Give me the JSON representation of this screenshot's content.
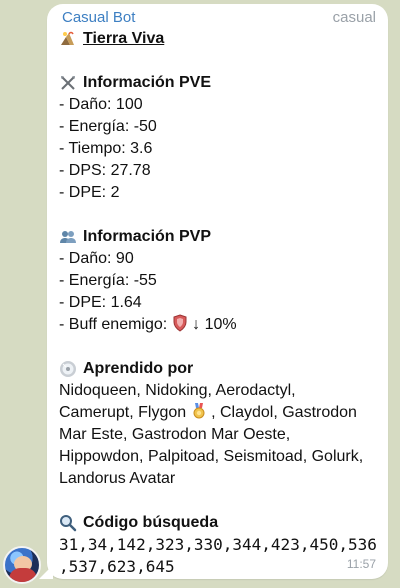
{
  "chat": {
    "sender": "Casual Bot",
    "tag": "casual",
    "time": "11:57"
  },
  "message": {
    "title": "Tierra Viva",
    "pve": {
      "title": "Información PVE",
      "lines": [
        "- Daño: 100",
        "- Energía: -50",
        "- Tiempo: 3.6",
        "- DPS: 27.78",
        "- DPE: 2"
      ]
    },
    "pvp": {
      "title": "Información PVP",
      "lines": [
        "- Daño: 90",
        "- Energía: -55",
        "- DPE: 1.64"
      ],
      "buff_prefix": "- Buff enemigo:",
      "buff_value": "↓ 10%"
    },
    "learned": {
      "title": "Aprendido por",
      "line1": "Nidoqueen, Nidoking, Aerodactyl,",
      "line2_prefix": "Camerupt, Flygon",
      "line2_suffix": ", Claydol, Gastrodon",
      "line3": "Mar Este, Gastrodon Mar Oeste,",
      "line4": "Hippowdon, Palpitoad, Seismitoad, Golurk,",
      "line5": "Landorus Avatar"
    },
    "search": {
      "title": "Código búsqueda",
      "code": "31,34,142,323,330,344,423,450,536,537,623,645"
    }
  },
  "icons": {
    "title": "volcano-icon",
    "pve": "crossed-swords-icon",
    "pvp": "users-icon",
    "learned": "disc-icon",
    "search": "magnifier-icon",
    "buff": "shield-icon",
    "medal": "medal-icon"
  },
  "colors": {
    "sender": "#3d7fc2",
    "muted": "#9aa1a8",
    "bubble": "#ffffff",
    "background": "#d6dbc2"
  }
}
